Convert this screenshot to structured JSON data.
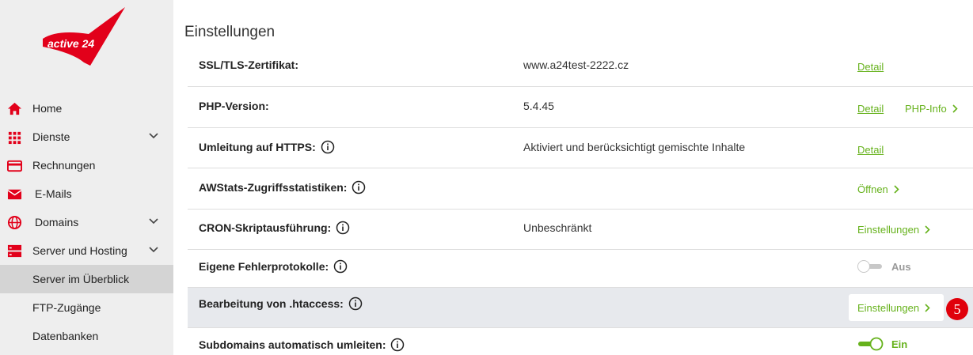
{
  "brand": {
    "logo_text": "active 24",
    "accent": "#e2001a",
    "link_color": "#66b21c"
  },
  "sidebar": {
    "items": [
      {
        "label": "Home",
        "icon": "home-icon"
      },
      {
        "label": "Dienste",
        "icon": "grid-icon",
        "expandable": true
      },
      {
        "label": "Rechnungen",
        "icon": "credit-card-icon"
      },
      {
        "label": "E-Mails",
        "icon": "envelope-icon"
      },
      {
        "label": "Domains",
        "icon": "globe-icon",
        "expandable": true
      },
      {
        "label": "Server und Hosting",
        "icon": "server-icon",
        "expandable": true
      }
    ],
    "subitems": [
      {
        "label": "Server im Überblick",
        "active": true
      },
      {
        "label": "FTP-Zugänge"
      },
      {
        "label": "Datenbanken"
      }
    ]
  },
  "main": {
    "title": "Einstellungen",
    "rows": [
      {
        "label": "SSL/TLS-Zertifikat:",
        "value": "www.a24test-2222.cz",
        "link": "Detail"
      },
      {
        "label": "PHP-Version:",
        "value": "5.4.45",
        "link": "Detail",
        "action": "PHP-Info"
      },
      {
        "label": "Umleitung auf HTTPS:",
        "value": "Aktiviert und berücksichtigt gemischte Inhalte",
        "link": "Detail"
      },
      {
        "label": "AWStats-Zugriffsstatistiken:",
        "action": "Öffnen"
      },
      {
        "label": "CRON-Skriptausführung:",
        "value": "Unbeschränkt",
        "action": "Einstellungen"
      },
      {
        "label": "Eigene Fehlerprotokolle:",
        "toggle": "Aus",
        "toggle_on": false
      },
      {
        "label": "Bearbeitung von .htaccess:",
        "action": "Einstellungen",
        "badge": "5",
        "highlighted": true
      },
      {
        "label": "Subdomains automatisch umleiten:",
        "toggle": "Ein",
        "toggle_on": true
      }
    ]
  }
}
